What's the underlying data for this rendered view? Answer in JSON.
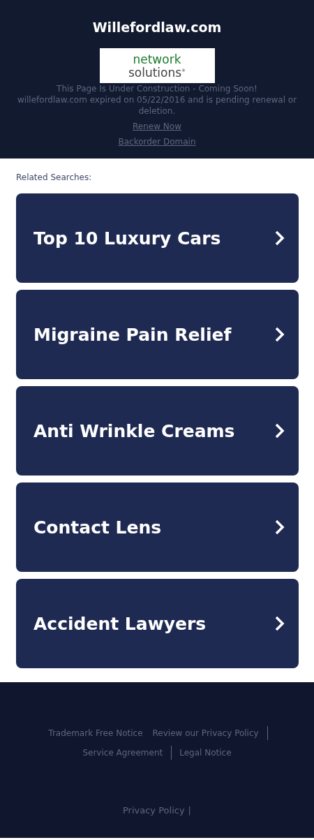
{
  "header": {
    "domain": "Willefordlaw.com",
    "logo": {
      "line_1": "network",
      "line_2": "solutions",
      "mark": "®"
    },
    "notice": "This Page Is Under Construction - Coming Soon!",
    "expiry": "willefordlaw.com expired on 05/22/2016 and is pending renewal or deletion.",
    "links": [
      "Renew Now",
      "Backorder Domain"
    ]
  },
  "related": {
    "label": "Related Searches:",
    "items": [
      {
        "text": "Top 10 Luxury Cars"
      },
      {
        "text": "Migraine Pain Relief"
      },
      {
        "text": "Anti Wrinkle Creams"
      },
      {
        "text": "Contact Lens"
      },
      {
        "text": "Accident Lawyers"
      }
    ]
  },
  "footer": {
    "links": [
      "Trademark Free Notice",
      "Review our Privacy Policy",
      "Service Agreement",
      "Legal Notice"
    ],
    "bottom_link": "Privacy Policy",
    "separator": "|"
  }
}
